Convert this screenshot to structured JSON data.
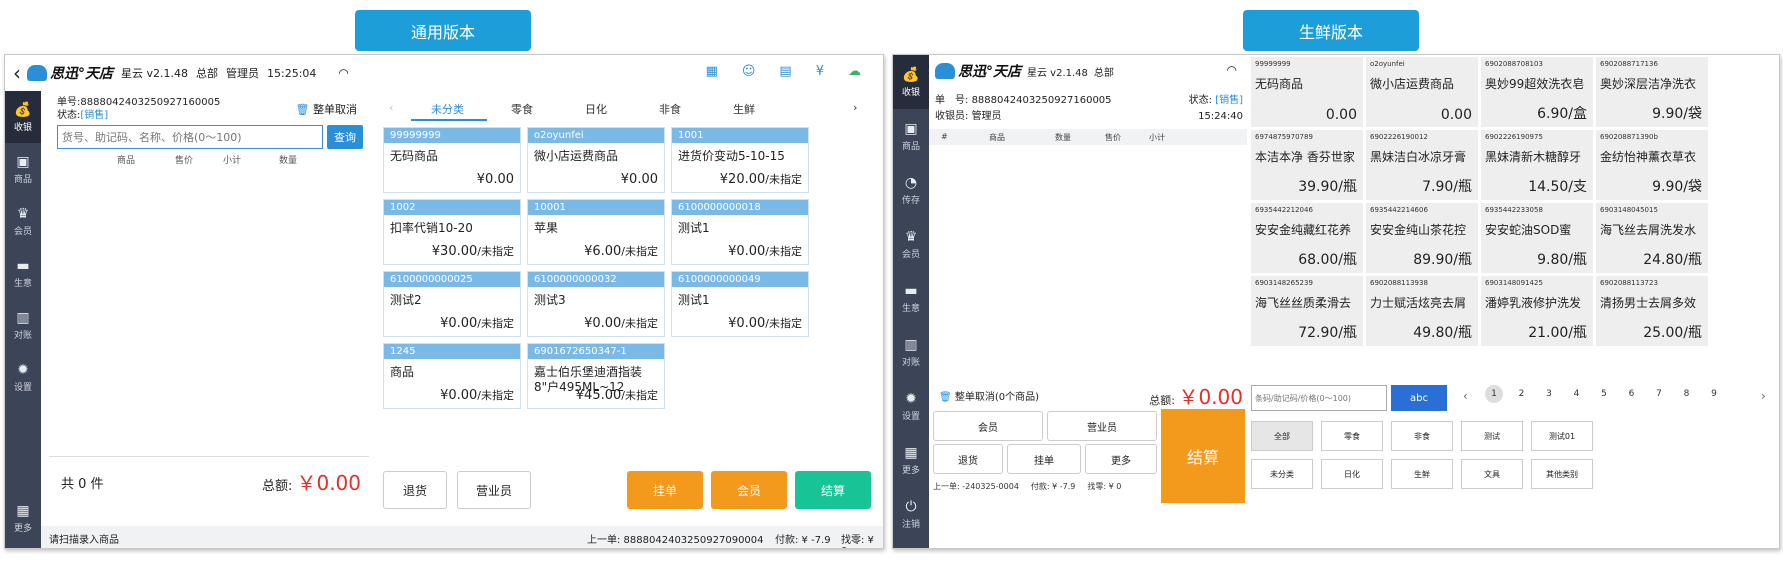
{
  "labels": {
    "general": "通用版本",
    "fresh": "生鲜版本"
  },
  "general": {
    "brand": "思迅°天店",
    "app": "星云 v2.1.48",
    "store": "总部",
    "user": "管理员",
    "time": "15:25:04",
    "order_label": "单号:",
    "order_no": "888804240325092716000​5",
    "status_label": "状态:",
    "status_value": "[销售]",
    "cancel_all": "整单取消",
    "search_placeholder": "货号、助记码、名称、价格(0～100)",
    "search_btn": "查询",
    "cols": [
      "商品",
      "售价",
      "小计",
      "数量"
    ],
    "count": "共 0 件",
    "total_label": "总额:",
    "total_value": "￥0.00",
    "hint": "请扫描录入商品",
    "last_order": "上一单: 8888042403250927090004",
    "paid": "付款: ¥ -7.9",
    "change": "找零: ¥ 0",
    "sidebar": [
      "收银",
      "商品",
      "会员",
      "生意",
      "对账",
      "设置",
      "更多"
    ],
    "tabs": [
      "未分类",
      "零食",
      "日化",
      "非食",
      "生鲜"
    ],
    "cards": [
      {
        "code": "99999999",
        "name": "无码商品",
        "price": "¥0.00",
        "unit": ""
      },
      {
        "code": "o2oyunfei",
        "name": "微小店运费商品",
        "price": "¥0.00",
        "unit": ""
      },
      {
        "code": "1001",
        "name": "进货价变动5-10-15",
        "price": "¥20.00",
        "unit": "/未指定"
      },
      {
        "code": "1002",
        "name": "扣率代销10-20",
        "price": "¥30.00",
        "unit": "/未指定"
      },
      {
        "code": "10001",
        "name": "苹果",
        "price": "¥6.00",
        "unit": "/未指定"
      },
      {
        "code": "6100000000018",
        "name": "测试1",
        "price": "¥0.00",
        "unit": "/未指定"
      },
      {
        "code": "6100000000025",
        "name": "测试2",
        "price": "¥0.00",
        "unit": "/未指定"
      },
      {
        "code": "6100000000032",
        "name": "测试3",
        "price": "¥0.00",
        "unit": "/未指定"
      },
      {
        "code": "6100000000049",
        "name": "测试1",
        "price": "¥0.00",
        "unit": "/未指定"
      },
      {
        "code": "1245",
        "name": "商品",
        "price": "¥0.00",
        "unit": "/未指定"
      },
      {
        "code": "6901672650347-1",
        "name": "嘉士伯乐堡迪酒指装8\"户495ML~12",
        "price": "¥45.00",
        "unit": "/未指定"
      }
    ],
    "buttons": [
      "退货",
      "营业员",
      "挂单",
      "会员",
      "结算"
    ]
  },
  "fresh": {
    "brand": "思迅°天店",
    "app": "星云 v2.1.48",
    "store": "总部",
    "order_label": "单　号:",
    "order_no": "888804240325092716000​5",
    "status_label": "状态:",
    "status_value": "[销售]",
    "cashier_label": "收银员:",
    "cashier": "管理员",
    "time": "15:24:40",
    "cols": [
      "#",
      "商品",
      "数量",
      "售价",
      "小计"
    ],
    "cancel_all": "整单取消(0个商品)",
    "total_label": "总额:",
    "total_value": "￥0.00",
    "buttons": [
      "会员",
      "营业员",
      "退货",
      "挂单",
      "更多"
    ],
    "settle": "结算",
    "last_order": "上一单: -240325-0004",
    "paid": "付款: ¥ -7.9",
    "change": "找零: ¥ 0",
    "sidebar": [
      "收银",
      "商品",
      "传存",
      "会员",
      "生意",
      "对账",
      "设置",
      "更多"
    ],
    "logout": "注销",
    "search_placeholder": "条码/助记码/价格(0～100)",
    "abc": "abc",
    "pages": [
      "1",
      "2",
      "3",
      "4",
      "5",
      "6",
      "7",
      "8",
      "9"
    ],
    "cats_row1": [
      "全部",
      "零食",
      "非食",
      "测试",
      "测试01"
    ],
    "cats_row2": [
      "未分类",
      "日化",
      "生鲜",
      "文具",
      "其他类别"
    ],
    "cards": [
      {
        "code": "99999999",
        "name": "无码商品",
        "price": "0.00"
      },
      {
        "code": "o2oyunfei",
        "name": "微小店运费商品",
        "price": "0.00"
      },
      {
        "code": "6902088708103",
        "name": "奥妙99超效洗衣皂",
        "price": "6.90/盒"
      },
      {
        "code": "6902088717136",
        "name": "奥妙深层洁净洗衣",
        "price": "9.90/袋"
      },
      {
        "code": "6974875970789",
        "name": "本洁本净 香芬世家",
        "price": "39.90/瓶"
      },
      {
        "code": "6902226190012",
        "name": "黑妹洁白冰凉牙膏",
        "price": "7.90/瓶"
      },
      {
        "code": "6902226190975",
        "name": "黑妹清新木糖醇牙",
        "price": "14.50/支"
      },
      {
        "code": "690208871390b",
        "name": "金纺怡神薰衣草衣",
        "price": "9.90/袋"
      },
      {
        "code": "6935442212046",
        "name": "安安金纯藏红花养",
        "price": "68.00/瓶"
      },
      {
        "code": "6935442214606",
        "name": "安安金纯山茶花控",
        "price": "89.90/瓶"
      },
      {
        "code": "6935442233058",
        "name": "安安蛇油SOD蜜",
        "price": "9.80/瓶"
      },
      {
        "code": "6903148045015",
        "name": "海飞丝去屑洗发水",
        "price": "24.80/瓶"
      },
      {
        "code": "6903148265239",
        "name": "海飞丝丝质柔滑去",
        "price": "72.90/瓶"
      },
      {
        "code": "6902088113938",
        "name": "力士赋活炫亮去屑",
        "price": "49.80/瓶"
      },
      {
        "code": "6903148091425",
        "name": "潘婷乳液修护洗发",
        "price": "21.00/瓶"
      },
      {
        "code": "6902088113723",
        "name": "清扬男士去屑多效",
        "price": "25.00/瓶"
      }
    ]
  }
}
